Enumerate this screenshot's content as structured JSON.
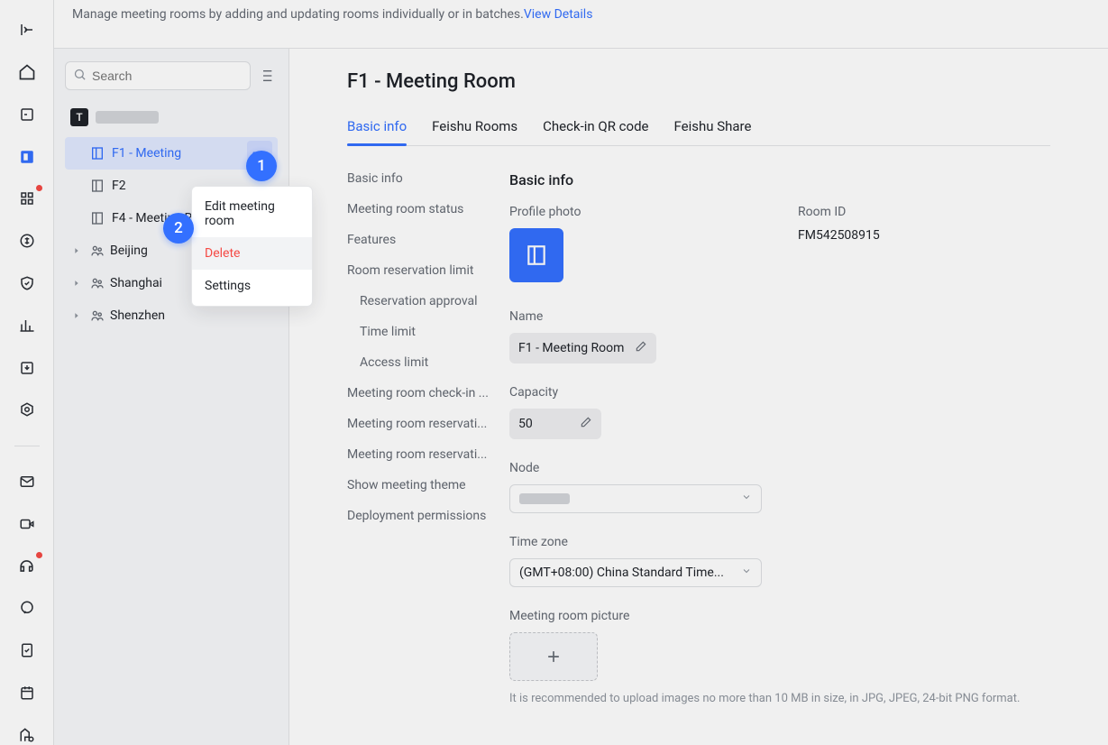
{
  "banner": {
    "text": "Manage meeting rooms by adding and updating rooms individually or in batches.",
    "link": "View Details"
  },
  "search": {
    "placeholder": "Search"
  },
  "root_badge": "T",
  "rooms": {
    "f1": "F1 - Meeting",
    "f2": "F2",
    "f4": "F4 - Meeting Room"
  },
  "cities": {
    "beijing": "Beijing",
    "shanghai": "Shanghai",
    "shenzhen": "Shenzhen"
  },
  "context_menu": {
    "edit": "Edit meeting room",
    "delete": "Delete",
    "settings": "Settings"
  },
  "callout": {
    "one": "1",
    "two": "2"
  },
  "page": {
    "title": "F1 - Meeting Room",
    "tabs": {
      "basic": "Basic info",
      "rooms": "Feishu Rooms",
      "qr": "Check-in QR code",
      "share": "Feishu Share"
    }
  },
  "section_nav": {
    "basic": "Basic info",
    "status": "Meeting room status",
    "features": "Features",
    "limit": "Room reservation limit",
    "approval": "Reservation approval",
    "time_limit": "Time limit",
    "access_limit": "Access limit",
    "checkin": "Meeting room check-in ...",
    "resv1": "Meeting room reservati...",
    "resv2": "Meeting room reservati...",
    "theme": "Show meeting theme",
    "deploy": "Deployment permissions"
  },
  "form": {
    "heading": "Basic info",
    "profile_photo_label": "Profile photo",
    "room_id_label": "Room ID",
    "room_id_value": "FM542508915",
    "name_label": "Name",
    "name_value": "F1 - Meeting Room",
    "capacity_label": "Capacity",
    "capacity_value": "50",
    "node_label": "Node",
    "timezone_label": "Time zone",
    "timezone_value": "(GMT+08:00) China Standard Time...",
    "picture_label": "Meeting room picture",
    "picture_help": "It is recommended to upload images no more than 10 MB in size, in JPG, JPEG, 24-bit PNG format."
  }
}
